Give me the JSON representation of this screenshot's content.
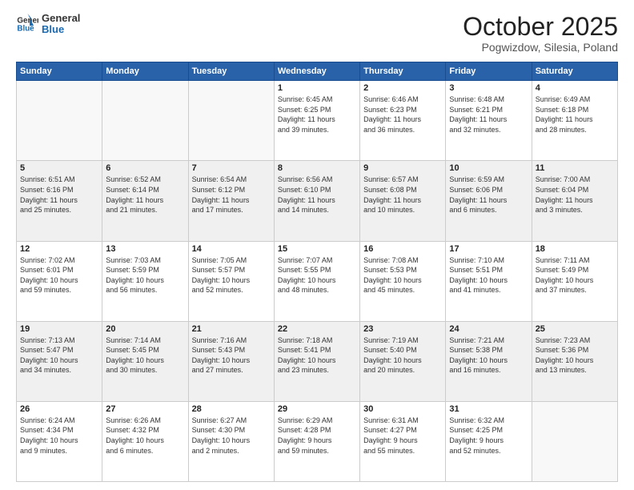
{
  "header": {
    "logo_line1": "General",
    "logo_line2": "Blue",
    "month_title": "October 2025",
    "location": "Pogwizdow, Silesia, Poland"
  },
  "weekdays": [
    "Sunday",
    "Monday",
    "Tuesday",
    "Wednesday",
    "Thursday",
    "Friday",
    "Saturday"
  ],
  "rows": [
    {
      "shaded": false,
      "cells": [
        {
          "day": "",
          "info": ""
        },
        {
          "day": "",
          "info": ""
        },
        {
          "day": "",
          "info": ""
        },
        {
          "day": "1",
          "info": "Sunrise: 6:45 AM\nSunset: 6:25 PM\nDaylight: 11 hours\nand 39 minutes."
        },
        {
          "day": "2",
          "info": "Sunrise: 6:46 AM\nSunset: 6:23 PM\nDaylight: 11 hours\nand 36 minutes."
        },
        {
          "day": "3",
          "info": "Sunrise: 6:48 AM\nSunset: 6:21 PM\nDaylight: 11 hours\nand 32 minutes."
        },
        {
          "day": "4",
          "info": "Sunrise: 6:49 AM\nSunset: 6:18 PM\nDaylight: 11 hours\nand 28 minutes."
        }
      ]
    },
    {
      "shaded": true,
      "cells": [
        {
          "day": "5",
          "info": "Sunrise: 6:51 AM\nSunset: 6:16 PM\nDaylight: 11 hours\nand 25 minutes."
        },
        {
          "day": "6",
          "info": "Sunrise: 6:52 AM\nSunset: 6:14 PM\nDaylight: 11 hours\nand 21 minutes."
        },
        {
          "day": "7",
          "info": "Sunrise: 6:54 AM\nSunset: 6:12 PM\nDaylight: 11 hours\nand 17 minutes."
        },
        {
          "day": "8",
          "info": "Sunrise: 6:56 AM\nSunset: 6:10 PM\nDaylight: 11 hours\nand 14 minutes."
        },
        {
          "day": "9",
          "info": "Sunrise: 6:57 AM\nSunset: 6:08 PM\nDaylight: 11 hours\nand 10 minutes."
        },
        {
          "day": "10",
          "info": "Sunrise: 6:59 AM\nSunset: 6:06 PM\nDaylight: 11 hours\nand 6 minutes."
        },
        {
          "day": "11",
          "info": "Sunrise: 7:00 AM\nSunset: 6:04 PM\nDaylight: 11 hours\nand 3 minutes."
        }
      ]
    },
    {
      "shaded": false,
      "cells": [
        {
          "day": "12",
          "info": "Sunrise: 7:02 AM\nSunset: 6:01 PM\nDaylight: 10 hours\nand 59 minutes."
        },
        {
          "day": "13",
          "info": "Sunrise: 7:03 AM\nSunset: 5:59 PM\nDaylight: 10 hours\nand 56 minutes."
        },
        {
          "day": "14",
          "info": "Sunrise: 7:05 AM\nSunset: 5:57 PM\nDaylight: 10 hours\nand 52 minutes."
        },
        {
          "day": "15",
          "info": "Sunrise: 7:07 AM\nSunset: 5:55 PM\nDaylight: 10 hours\nand 48 minutes."
        },
        {
          "day": "16",
          "info": "Sunrise: 7:08 AM\nSunset: 5:53 PM\nDaylight: 10 hours\nand 45 minutes."
        },
        {
          "day": "17",
          "info": "Sunrise: 7:10 AM\nSunset: 5:51 PM\nDaylight: 10 hours\nand 41 minutes."
        },
        {
          "day": "18",
          "info": "Sunrise: 7:11 AM\nSunset: 5:49 PM\nDaylight: 10 hours\nand 37 minutes."
        }
      ]
    },
    {
      "shaded": true,
      "cells": [
        {
          "day": "19",
          "info": "Sunrise: 7:13 AM\nSunset: 5:47 PM\nDaylight: 10 hours\nand 34 minutes."
        },
        {
          "day": "20",
          "info": "Sunrise: 7:14 AM\nSunset: 5:45 PM\nDaylight: 10 hours\nand 30 minutes."
        },
        {
          "day": "21",
          "info": "Sunrise: 7:16 AM\nSunset: 5:43 PM\nDaylight: 10 hours\nand 27 minutes."
        },
        {
          "day": "22",
          "info": "Sunrise: 7:18 AM\nSunset: 5:41 PM\nDaylight: 10 hours\nand 23 minutes."
        },
        {
          "day": "23",
          "info": "Sunrise: 7:19 AM\nSunset: 5:40 PM\nDaylight: 10 hours\nand 20 minutes."
        },
        {
          "day": "24",
          "info": "Sunrise: 7:21 AM\nSunset: 5:38 PM\nDaylight: 10 hours\nand 16 minutes."
        },
        {
          "day": "25",
          "info": "Sunrise: 7:23 AM\nSunset: 5:36 PM\nDaylight: 10 hours\nand 13 minutes."
        }
      ]
    },
    {
      "shaded": false,
      "cells": [
        {
          "day": "26",
          "info": "Sunrise: 6:24 AM\nSunset: 4:34 PM\nDaylight: 10 hours\nand 9 minutes."
        },
        {
          "day": "27",
          "info": "Sunrise: 6:26 AM\nSunset: 4:32 PM\nDaylight: 10 hours\nand 6 minutes."
        },
        {
          "day": "28",
          "info": "Sunrise: 6:27 AM\nSunset: 4:30 PM\nDaylight: 10 hours\nand 2 minutes."
        },
        {
          "day": "29",
          "info": "Sunrise: 6:29 AM\nSunset: 4:28 PM\nDaylight: 9 hours\nand 59 minutes."
        },
        {
          "day": "30",
          "info": "Sunrise: 6:31 AM\nSunset: 4:27 PM\nDaylight: 9 hours\nand 55 minutes."
        },
        {
          "day": "31",
          "info": "Sunrise: 6:32 AM\nSunset: 4:25 PM\nDaylight: 9 hours\nand 52 minutes."
        },
        {
          "day": "",
          "info": ""
        }
      ]
    }
  ]
}
